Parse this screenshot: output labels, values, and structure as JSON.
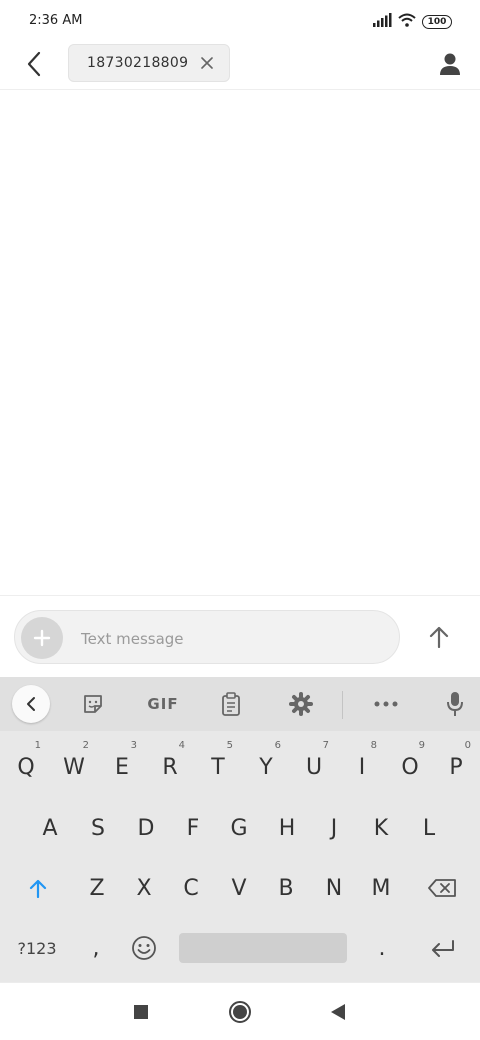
{
  "status_bar": {
    "time": "2:36 AM",
    "battery": "100",
    "icons": [
      "signal-icon",
      "wifi-icon",
      "battery-icon"
    ]
  },
  "header": {
    "back_icon": "back-arrow-icon",
    "recipient": "18730218809",
    "chip_close_icon": "close-icon",
    "contact_icon": "person-icon"
  },
  "compose": {
    "add_icon": "plus-icon",
    "placeholder": "Text message",
    "send_icon": "up-arrow-icon"
  },
  "keyboard": {
    "toolbar": {
      "collapse_icon": "chevron-left-icon",
      "sticker_icon": "sticker-icon",
      "gif_label": "GIF",
      "clipboard_icon": "clipboard-icon",
      "settings_icon": "gear-icon",
      "more_icon": "more-dots-icon",
      "mic_icon": "microphone-icon"
    },
    "row1": [
      {
        "label": "Q",
        "hint": "1"
      },
      {
        "label": "W",
        "hint": "2"
      },
      {
        "label": "E",
        "hint": "3"
      },
      {
        "label": "R",
        "hint": "4"
      },
      {
        "label": "T",
        "hint": "5"
      },
      {
        "label": "Y",
        "hint": "6"
      },
      {
        "label": "U",
        "hint": "7"
      },
      {
        "label": "I",
        "hint": "8"
      },
      {
        "label": "O",
        "hint": "9"
      },
      {
        "label": "P",
        "hint": "0"
      }
    ],
    "row2": [
      "A",
      "S",
      "D",
      "F",
      "G",
      "H",
      "J",
      "K",
      "L"
    ],
    "row3": [
      "Z",
      "X",
      "C",
      "V",
      "B",
      "N",
      "M"
    ],
    "shift_icon": "shift-arrow-icon",
    "backspace_icon": "backspace-icon",
    "symbols_label": "?123",
    "comma": ",",
    "emoji_icon": "emoji-icon",
    "period": ".",
    "enter_icon": "enter-icon"
  },
  "nav_bar": {
    "recents_icon": "square-icon",
    "home_icon": "circle-icon",
    "back_icon": "triangle-back-icon"
  },
  "colors": {
    "accent": "#2196f3",
    "keyboard_bg": "#e8e8e8",
    "toolbar_bg": "#e0e0e0"
  }
}
